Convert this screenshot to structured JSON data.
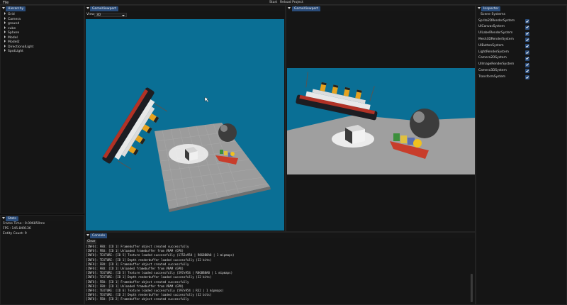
{
  "menubar": {
    "file": "File",
    "start": "Start",
    "reload": "Reload Project"
  },
  "hierarchy": {
    "tab": "Hierarchy",
    "items": [
      "Grid",
      "Camera",
      "ground",
      "cube",
      "Sphere",
      "Model",
      "Model2",
      "DirectionalLight",
      "SpotLight"
    ]
  },
  "game_viewport": {
    "tab": "GameViewport",
    "view_label": "View",
    "view_value": "3D"
  },
  "game_viewport_2": {
    "tab": "GameViewport"
  },
  "inspector": {
    "tab": "Inspector",
    "section": "Scene Systems",
    "systems": [
      {
        "label": "Sprite2DRenderSystem",
        "checked": true
      },
      {
        "label": "UICanvasSystem",
        "checked": true
      },
      {
        "label": "UILabelRenderSystem",
        "checked": true
      },
      {
        "label": "Mesh3DRenderSystem",
        "checked": true
      },
      {
        "label": "UIButtonSystem",
        "checked": true
      },
      {
        "label": "LightRenderSystem",
        "checked": true
      },
      {
        "label": "Camera2DSystem",
        "checked": true
      },
      {
        "label": "UIImageRenderSystem",
        "checked": true
      },
      {
        "label": "Camera3DSystem",
        "checked": true
      },
      {
        "label": "TransformSystem",
        "checked": true
      }
    ]
  },
  "stats": {
    "tab": "Stats",
    "frame_time": "Frame Time : 0.006850ms",
    "fps": "FPS       : 145.849136",
    "entity_count": "Entity Count: 9"
  },
  "console": {
    "tab": "Console",
    "clear": "Clear",
    "lines": [
      "[INFO]: FBO: [ID 1] Framebuffer object created successfully",
      "[INFO]: FBO: [ID 1] Unloaded framebuffer from VRAM (GPU)",
      "[INFO]: TEXTURE: [ID 5] Texture loaded successfully (1752x954 | R8G8B8A8 | 1 mipmaps)",
      "[INFO]: TEXTURE: [ID 1] Depth renderbuffer loaded successfully (32 bits)",
      "[INFO]: FBO: [ID 1] Framebuffer object created successfully",
      "[INFO]: FBO: [ID 1] Unloaded framebuffer from VRAM (GPU)",
      "[INFO]: TEXTURE: [ID 5] Texture loaded successfully (597x954 | R8G8B8A8 | 1 mipmaps)",
      "[INFO]: TEXTURE: [ID 1] Depth renderbuffer loaded successfully (32 bits)",
      "[INFO]: FBO: [ID 1] Framebuffer object created successfully",
      "[INFO]: FBO: [ID 1] Unloaded framebuffer from VRAM (GPU)",
      "[INFO]: TEXTURE: [ID 6] Texture loaded successfully (597x954 | R32 | 1 mipmaps)",
      "[INFO]: TEXTURE: [ID 2] Depth renderbuffer loaded successfully (32 bits)",
      "[INFO]: FBO: [ID 2] Framebuffer object created successfully"
    ]
  },
  "colors": {
    "accent": "#2a4c7a",
    "sky": "#0a6f95",
    "panel": "#151515"
  }
}
